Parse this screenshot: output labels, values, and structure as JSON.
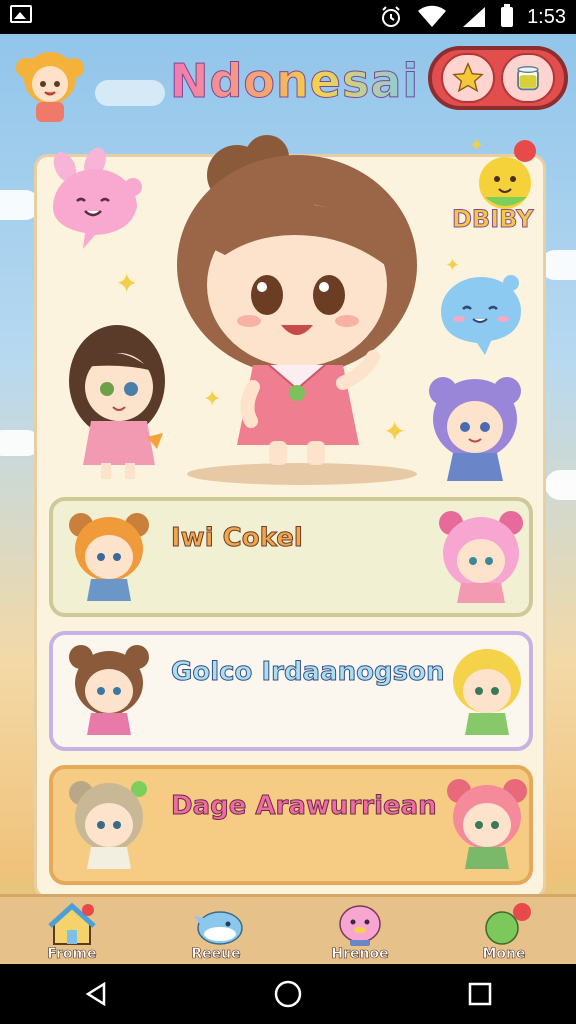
{
  "status_bar": {
    "time": "1:53",
    "icons": [
      "gallery-icon",
      "alarm-icon",
      "wifi-icon",
      "signal-icon",
      "battery-icon"
    ]
  },
  "header": {
    "title": "Ndonesai",
    "buttons": [
      "star-icon",
      "cup-icon"
    ]
  },
  "hero": {
    "brand_label": "DBIBY"
  },
  "menu": [
    {
      "label": "Iwi Cokel"
    },
    {
      "label": "Golco Irdaanogson"
    },
    {
      "label": "Dage Arawurriean"
    }
  ],
  "bottom_nav": [
    {
      "label": "Frome",
      "icon": "home-icon"
    },
    {
      "label": "Reeue",
      "icon": "whale-icon"
    },
    {
      "label": "Hrenoe",
      "icon": "pig-icon"
    },
    {
      "label": "Mone",
      "icon": "balloon-icon"
    }
  ],
  "colors": {
    "sky": "#8ec3ea",
    "panel": "#fbf3dd",
    "accent_red": "#e24d4d",
    "nav_bar": "#e7c18a"
  }
}
